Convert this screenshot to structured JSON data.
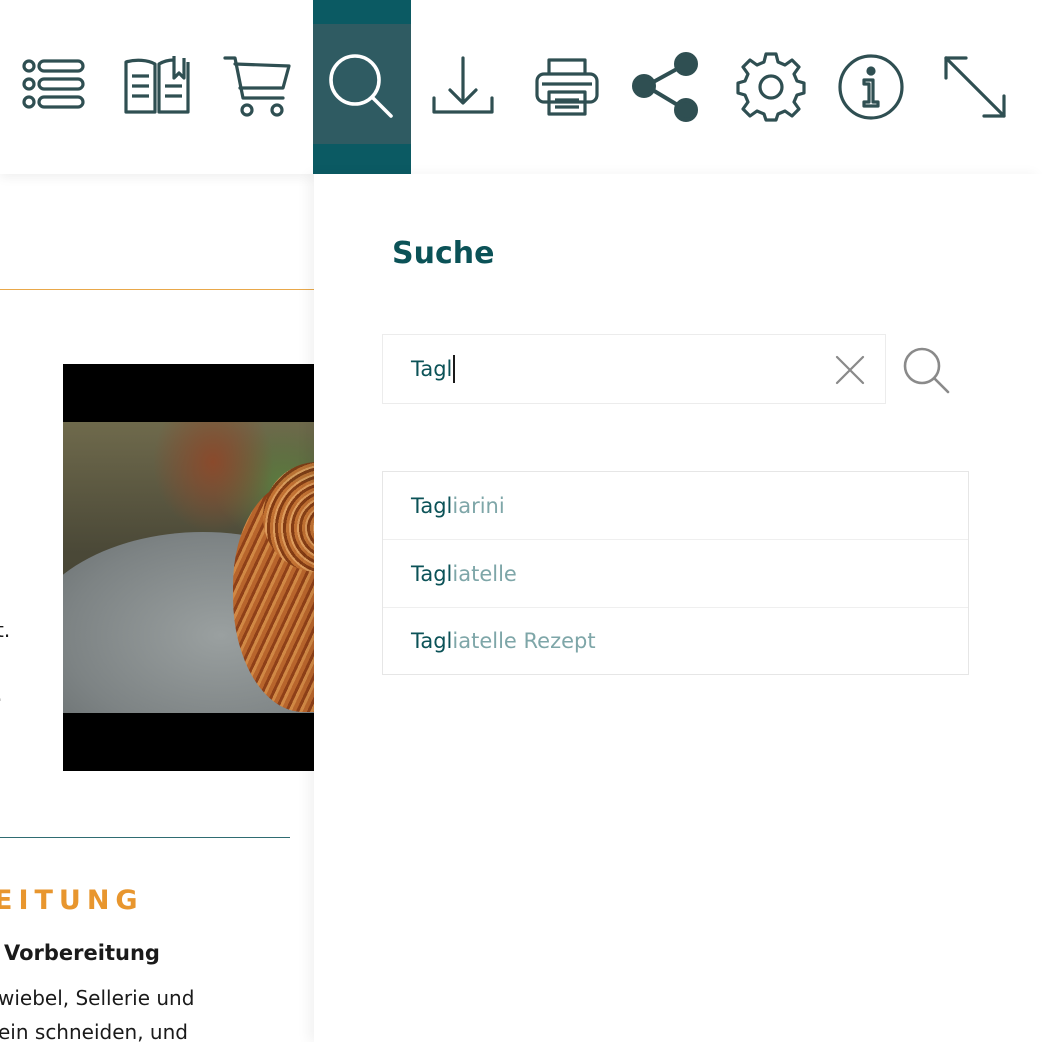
{
  "colors": {
    "accent": "#0b5a63",
    "icon": "#2f4f52",
    "title": "#0b5257",
    "suggestion_rest": "#7ea6a8",
    "heading_orange": "#e8962e"
  },
  "toolbar": {
    "items": [
      {
        "icon": "list-icon"
      },
      {
        "icon": "book-icon"
      },
      {
        "icon": "cart-icon"
      },
      {
        "icon": "search-icon",
        "active": true
      },
      {
        "icon": "download-icon"
      },
      {
        "icon": "print-icon"
      },
      {
        "icon": "share-icon"
      },
      {
        "icon": "gear-icon"
      },
      {
        "icon": "info-icon"
      },
      {
        "icon": "fullscreen-icon"
      }
    ]
  },
  "document": {
    "fragment_t": "t.",
    "fragment_dot": ".",
    "section_heading": "EITUNG",
    "subheading": "Vorbereitung",
    "body_line_1": "wiebel, Sellerie und",
    "body_line_2": "ein schneiden, und"
  },
  "search_panel": {
    "title": "Suche",
    "query": "Tagl",
    "suggestions": [
      {
        "match": "Tagl",
        "rest": "iarini"
      },
      {
        "match": "Tagl",
        "rest": "iatelle"
      },
      {
        "match": "Tagl",
        "rest": "iatelle Rezept"
      }
    ]
  }
}
